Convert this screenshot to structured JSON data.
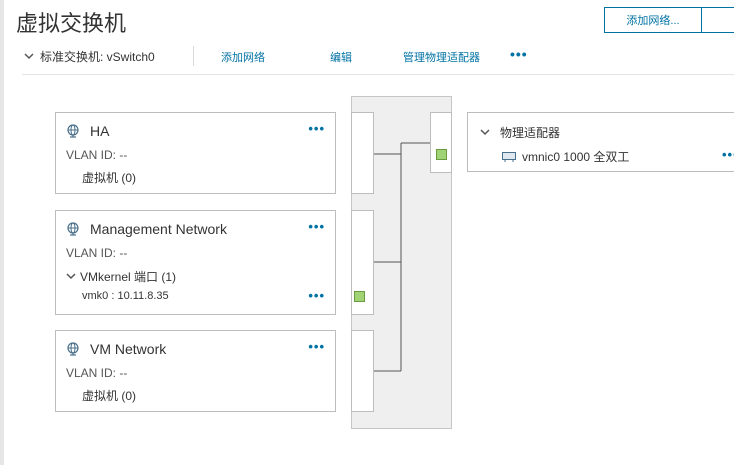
{
  "page": {
    "title": "虚拟交换机"
  },
  "top_actions": {
    "add_network": "添加网络...",
    "secondary": ""
  },
  "toolbar": {
    "switch_label": "标准交换机: vSwitch0",
    "add_network": "添加网络",
    "edit": "编辑",
    "manage_adapters": "管理物理适配器",
    "more": "•••"
  },
  "port_groups": [
    {
      "name": "HA",
      "vlan": "VLAN ID: --",
      "vms": "虚拟机 (0)",
      "more": "•••"
    },
    {
      "name": "Management Network",
      "vlan": "VLAN ID: --",
      "vmkernel": "VMkernel 端口 (1)",
      "vmk": "vmk0 : 10.11.8.35",
      "more": "•••",
      "vmk_more": "•••"
    },
    {
      "name": "VM Network",
      "vlan": "VLAN ID: --",
      "vms": "虚拟机 (0)",
      "more": "•••"
    }
  ],
  "physical_adapters": {
    "title": "物理适配器",
    "nic": "vmnic0 1000 全双工",
    "more": "•••"
  },
  "colors": {
    "link": "#0072a3",
    "port_led": "#9fd373",
    "switch_bg": "#efefef"
  }
}
